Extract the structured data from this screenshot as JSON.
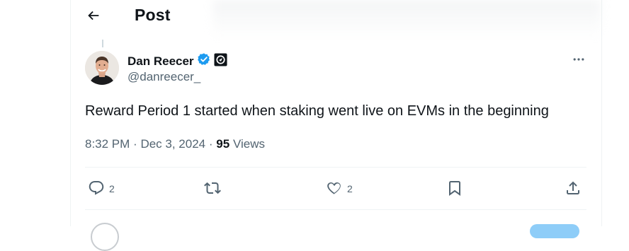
{
  "header": {
    "back_icon": "arrow-left-icon",
    "title": "Post"
  },
  "author": {
    "name": "Dan Reecer",
    "handle": "@danreecer_",
    "verified_icon": "verified-badge-icon",
    "affiliate_icon": "affiliate-badge-icon",
    "more_icon": "more-horizontal-icon"
  },
  "post": {
    "text": "Reward Period 1 started when staking went live on EVMs in the beginning",
    "time": "8:32 PM",
    "date": "Dec 3, 2024",
    "separator": "·",
    "views_count": "95",
    "views_label": "Views"
  },
  "actions": {
    "reply_count": "2",
    "repost_count": "",
    "like_count": "2",
    "icons": [
      "reply-icon",
      "repost-icon",
      "like-icon",
      "bookmark-icon",
      "share-icon"
    ]
  },
  "colors": {
    "text_primary": "#0f1419",
    "text_secondary": "#536471",
    "verified_blue": "#1d9bf0",
    "border": "#eff3f4"
  }
}
